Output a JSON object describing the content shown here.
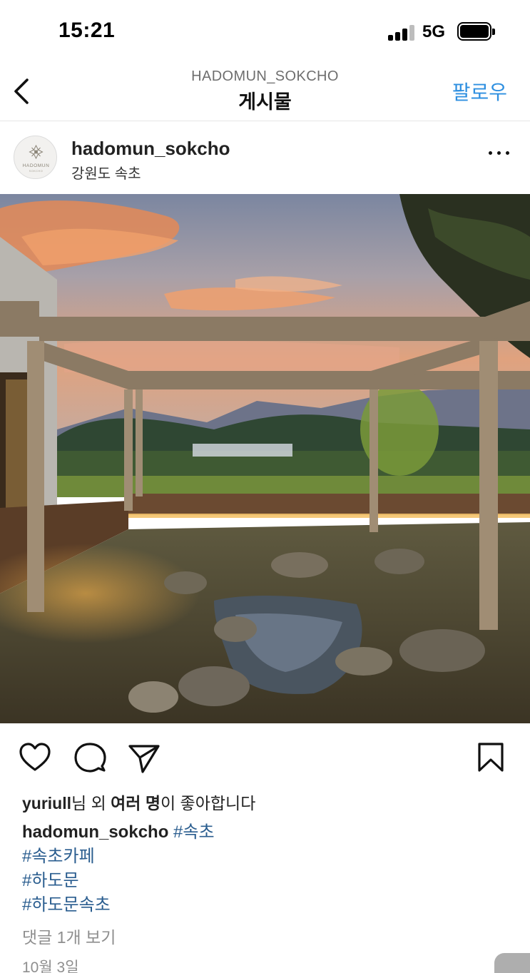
{
  "status_bar": {
    "time": "15:21",
    "network": "5G"
  },
  "nav": {
    "account": "HADOMUN_SOKCHO",
    "title": "게시물",
    "follow_label": "팔로우"
  },
  "post": {
    "username": "hadomun_sokcho",
    "location": "강원도 속초",
    "avatar_text": "HADOMUN",
    "avatar_subtext": "SOKCHO",
    "photo_alt": "Courtyard with wooden pergola, rock pond and sunset over mountains",
    "likes": {
      "user": "yuriull",
      "suffix1": "님 외 ",
      "bold": "여러 명",
      "suffix2": "이 좋아합니다"
    },
    "caption": {
      "user": "hadomun_sokcho",
      "tags": [
        "#속초",
        "#속초카페",
        "#하도문",
        "#하도문속초"
      ]
    },
    "comments_link": "댓글 1개 보기",
    "date": "10월 3일"
  },
  "colors": {
    "accent": "#2e8fe0",
    "hashtag": "#2a5d8f",
    "muted": "#8e8e8e"
  }
}
